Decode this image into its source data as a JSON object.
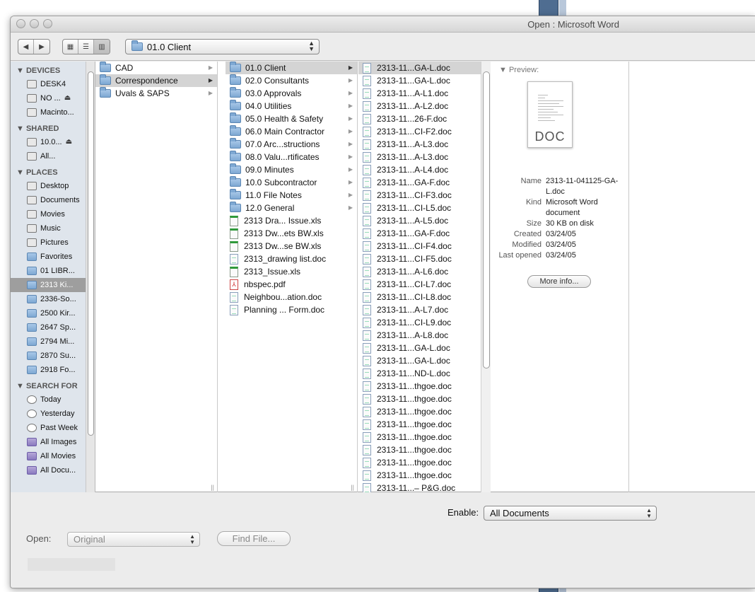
{
  "window": {
    "title": "Open : Microsoft Word"
  },
  "toolbar": {
    "back_icon": "back-arrow",
    "forward_icon": "forward-arrow",
    "view_icons": [
      "icon-view",
      "list-view",
      "column-view"
    ],
    "location": "01.0 Client"
  },
  "sidebar": {
    "devices": {
      "heading": "DEVICES",
      "items": [
        {
          "label": "DESK4",
          "icon": "hard-drive-icon"
        },
        {
          "label": "NO ...",
          "icon": "disk-icon",
          "eject": true
        },
        {
          "label": "Macinto...",
          "icon": "hard-drive-icon"
        }
      ]
    },
    "shared": {
      "heading": "SHARED",
      "items": [
        {
          "label": "10.0...",
          "icon": "monitor-icon",
          "eject": true
        },
        {
          "label": "All...",
          "icon": "network-icon"
        }
      ]
    },
    "places": {
      "heading": "PLACES",
      "items": [
        {
          "label": "Desktop",
          "icon": "desktop-icon"
        },
        {
          "label": "Documents",
          "icon": "documents-icon"
        },
        {
          "label": "Movies",
          "icon": "movies-icon"
        },
        {
          "label": "Music",
          "icon": "music-icon"
        },
        {
          "label": "Pictures",
          "icon": "pictures-icon"
        },
        {
          "label": "Favorites",
          "icon": "folder-icon"
        },
        {
          "label": "01 LIBR...",
          "icon": "folder-icon"
        },
        {
          "label": "2313 Ki...",
          "icon": "folder-icon",
          "selected": true
        },
        {
          "label": "2336-So...",
          "icon": "folder-icon"
        },
        {
          "label": "2500 Kir...",
          "icon": "folder-icon"
        },
        {
          "label": "2647 Sp...",
          "icon": "folder-icon"
        },
        {
          "label": "2794 Mi...",
          "icon": "folder-icon"
        },
        {
          "label": "2870 Su...",
          "icon": "folder-icon"
        },
        {
          "label": "2918 Fo...",
          "icon": "folder-icon"
        }
      ]
    },
    "search": {
      "heading": "SEARCH FOR",
      "items": [
        {
          "label": "Today",
          "icon": "clock-icon"
        },
        {
          "label": "Yesterday",
          "icon": "clock-icon"
        },
        {
          "label": "Past Week",
          "icon": "clock-icon"
        },
        {
          "label": "All Images",
          "icon": "smart-folder-icon"
        },
        {
          "label": "All Movies",
          "icon": "smart-folder-icon"
        },
        {
          "label": "All Docu...",
          "icon": "smart-folder-icon"
        }
      ]
    }
  },
  "column1": [
    {
      "label": "CAD",
      "type": "folder"
    },
    {
      "label": "Correspondence",
      "type": "folder",
      "selected": true
    },
    {
      "label": "Uvals & SAPS",
      "type": "folder"
    }
  ],
  "column2": [
    {
      "label": "01.0 Client",
      "type": "folder",
      "selected": true
    },
    {
      "label": "02.0 Consultants",
      "type": "folder"
    },
    {
      "label": "03.0 Approvals",
      "type": "folder"
    },
    {
      "label": "04.0 Utilities",
      "type": "folder"
    },
    {
      "label": "05.0 Health & Safety",
      "type": "folder"
    },
    {
      "label": "06.0 Main Contractor",
      "type": "folder"
    },
    {
      "label": "07.0 Arc...structions",
      "type": "folder"
    },
    {
      "label": "08.0 Valu...rtificates",
      "type": "folder"
    },
    {
      "label": "09.0 Minutes",
      "type": "folder"
    },
    {
      "label": "10.0 Subcontractor",
      "type": "folder"
    },
    {
      "label": "11.0 File Notes",
      "type": "folder"
    },
    {
      "label": "12.0 General",
      "type": "folder"
    },
    {
      "label": "2313 Dra... Issue.xls",
      "type": "xls"
    },
    {
      "label": "2313 Dw...ets BW.xls",
      "type": "xls"
    },
    {
      "label": "2313 Dw...se BW.xls",
      "type": "xls"
    },
    {
      "label": "2313_drawing list.doc",
      "type": "doc"
    },
    {
      "label": "2313_Issue.xls",
      "type": "xls"
    },
    {
      "label": "nbspec.pdf",
      "type": "pdf"
    },
    {
      "label": "Neighbou...ation.doc",
      "type": "doc"
    },
    {
      "label": "Planning ... Form.doc",
      "type": "doc"
    }
  ],
  "column3": [
    {
      "label": "2313-11...GA-L.doc",
      "selected": true
    },
    {
      "label": "2313-11...GA-L.doc"
    },
    {
      "label": "2313-11...A-L1.doc"
    },
    {
      "label": "2313-11...A-L2.doc"
    },
    {
      "label": "2313-11...26-F.doc"
    },
    {
      "label": "2313-11...CI-F2.doc"
    },
    {
      "label": "2313-11...A-L3.doc"
    },
    {
      "label": "2313-11...A-L3.doc"
    },
    {
      "label": "2313-11...A-L4.doc"
    },
    {
      "label": "2313-11...GA-F.doc"
    },
    {
      "label": "2313-11...CI-F3.doc"
    },
    {
      "label": "2313-11...CI-L5.doc"
    },
    {
      "label": "2313-11...A-L5.doc"
    },
    {
      "label": "2313-11...GA-F.doc"
    },
    {
      "label": "2313-11...CI-F4.doc"
    },
    {
      "label": "2313-11...CI-F5.doc"
    },
    {
      "label": "2313-11...A-L6.doc"
    },
    {
      "label": "2313-11...CI-L7.doc"
    },
    {
      "label": "2313-11...CI-L8.doc"
    },
    {
      "label": "2313-11...A-L7.doc"
    },
    {
      "label": "2313-11...CI-L9.doc"
    },
    {
      "label": "2313-11...A-L8.doc"
    },
    {
      "label": "2313-11...GA-L.doc"
    },
    {
      "label": "2313-11...GA-L.doc"
    },
    {
      "label": "2313-11...ND-L.doc"
    },
    {
      "label": "2313-11...thgoe.doc"
    },
    {
      "label": "2313-11...thgoe.doc"
    },
    {
      "label": "2313-11...thgoe.doc"
    },
    {
      "label": "2313-11...thgoe.doc"
    },
    {
      "label": "2313-11...thgoe.doc"
    },
    {
      "label": "2313-11...thgoe.doc"
    },
    {
      "label": "2313-11...thgoe.doc"
    },
    {
      "label": "2313-11...thgoe.doc"
    },
    {
      "label": "2313-11...– P&G.doc"
    }
  ],
  "preview": {
    "heading": "Preview:",
    "thumbnail_ext": "DOC",
    "fields": [
      {
        "key": "Name",
        "value": "2313-11-041125-GA-L.doc"
      },
      {
        "key": "Kind",
        "value": "Microsoft Word document"
      },
      {
        "key": "Size",
        "value": "30 KB on disk"
      },
      {
        "key": "Created",
        "value": "03/24/05"
      },
      {
        "key": "Modified",
        "value": "03/24/05"
      },
      {
        "key": "Last opened",
        "value": "03/24/05"
      }
    ],
    "more_info": "More info..."
  },
  "bottom": {
    "enable_label": "Enable:",
    "enable_value": "All Documents",
    "open_label": "Open:",
    "open_value": "Original",
    "find_file": "Find File..."
  }
}
